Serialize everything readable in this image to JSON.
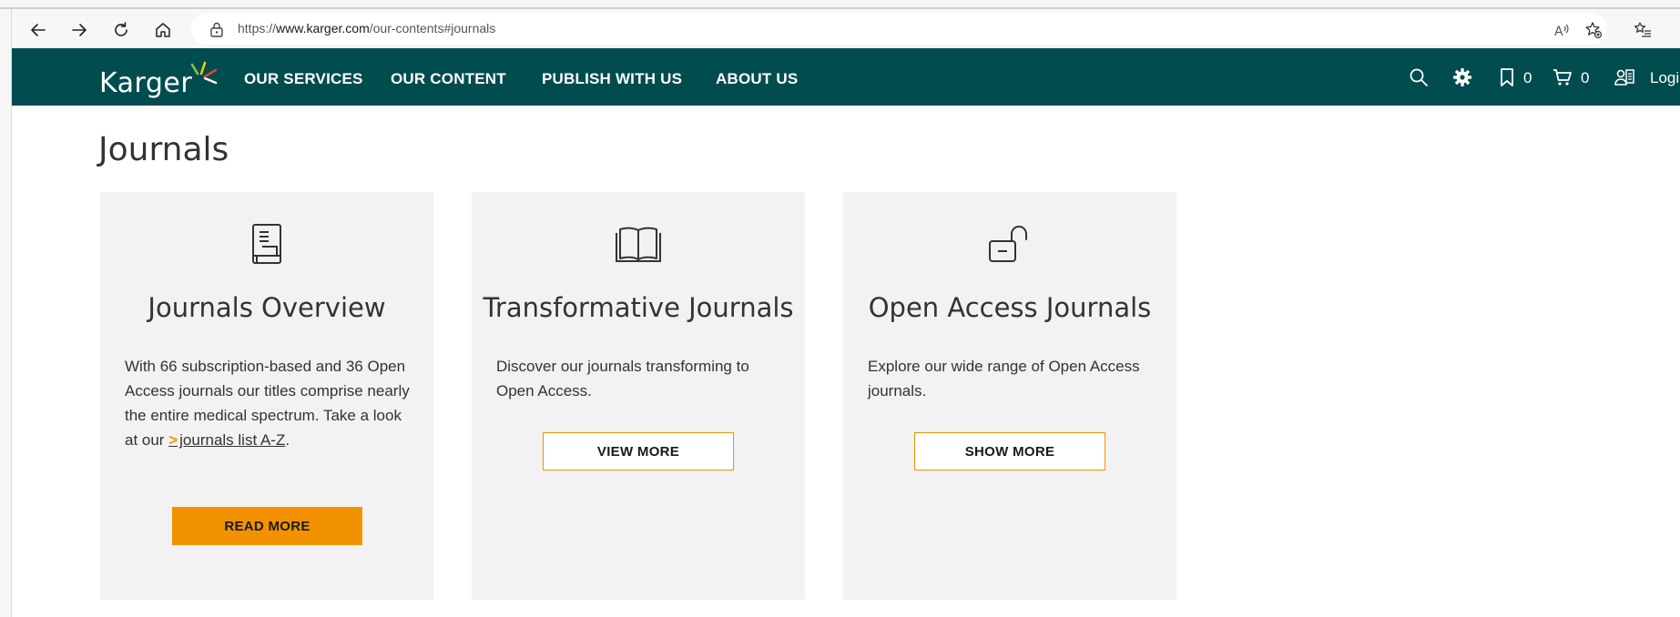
{
  "browser": {
    "url_scheme": "https://",
    "url_host": "www.karger.com",
    "url_path": "/our-contents#journals",
    "icons": {
      "back": "arrow-left-icon",
      "forward": "arrow-right-icon",
      "reload": "reload-icon",
      "home": "home-icon",
      "site_info": "lock-icon",
      "read_aloud": "read-aloud-icon",
      "favorite": "star-add-icon",
      "favorites": "favorites-list-icon"
    }
  },
  "header": {
    "logo_text": "Karger",
    "menu": [
      {
        "label": "OUR SERVICES"
      },
      {
        "label": "OUR CONTENT"
      },
      {
        "label": "PUBLISH WITH US"
      },
      {
        "label": "ABOUT US"
      }
    ],
    "bookmark_count": "0",
    "cart_count": "0",
    "login_label": "Logi",
    "colors": {
      "header_bg": "#004c4f",
      "accent": "#f39200"
    }
  },
  "main": {
    "title": "Journals",
    "cards": [
      {
        "icon": "book-icon",
        "title": "Journals Overview",
        "text_before_link": "With 66 subscription-based and 36 Open Access journals our titles comprise nearly the entire medical spectrum. Take a look at our ",
        "link_chevron": ">",
        "link_label": "journals list A-Z",
        "text_after_link": ".",
        "button_label": "READ MORE"
      },
      {
        "icon": "open-book-icon",
        "title": "Transformative Journals",
        "text": "Discover our journals transforming to Open Access.",
        "button_label": "VIEW MORE"
      },
      {
        "icon": "open-lock-icon",
        "title": "Open Access Journals",
        "text": "Explore our wide range of Open Access journals.",
        "button_label": "SHOW MORE"
      }
    ]
  }
}
